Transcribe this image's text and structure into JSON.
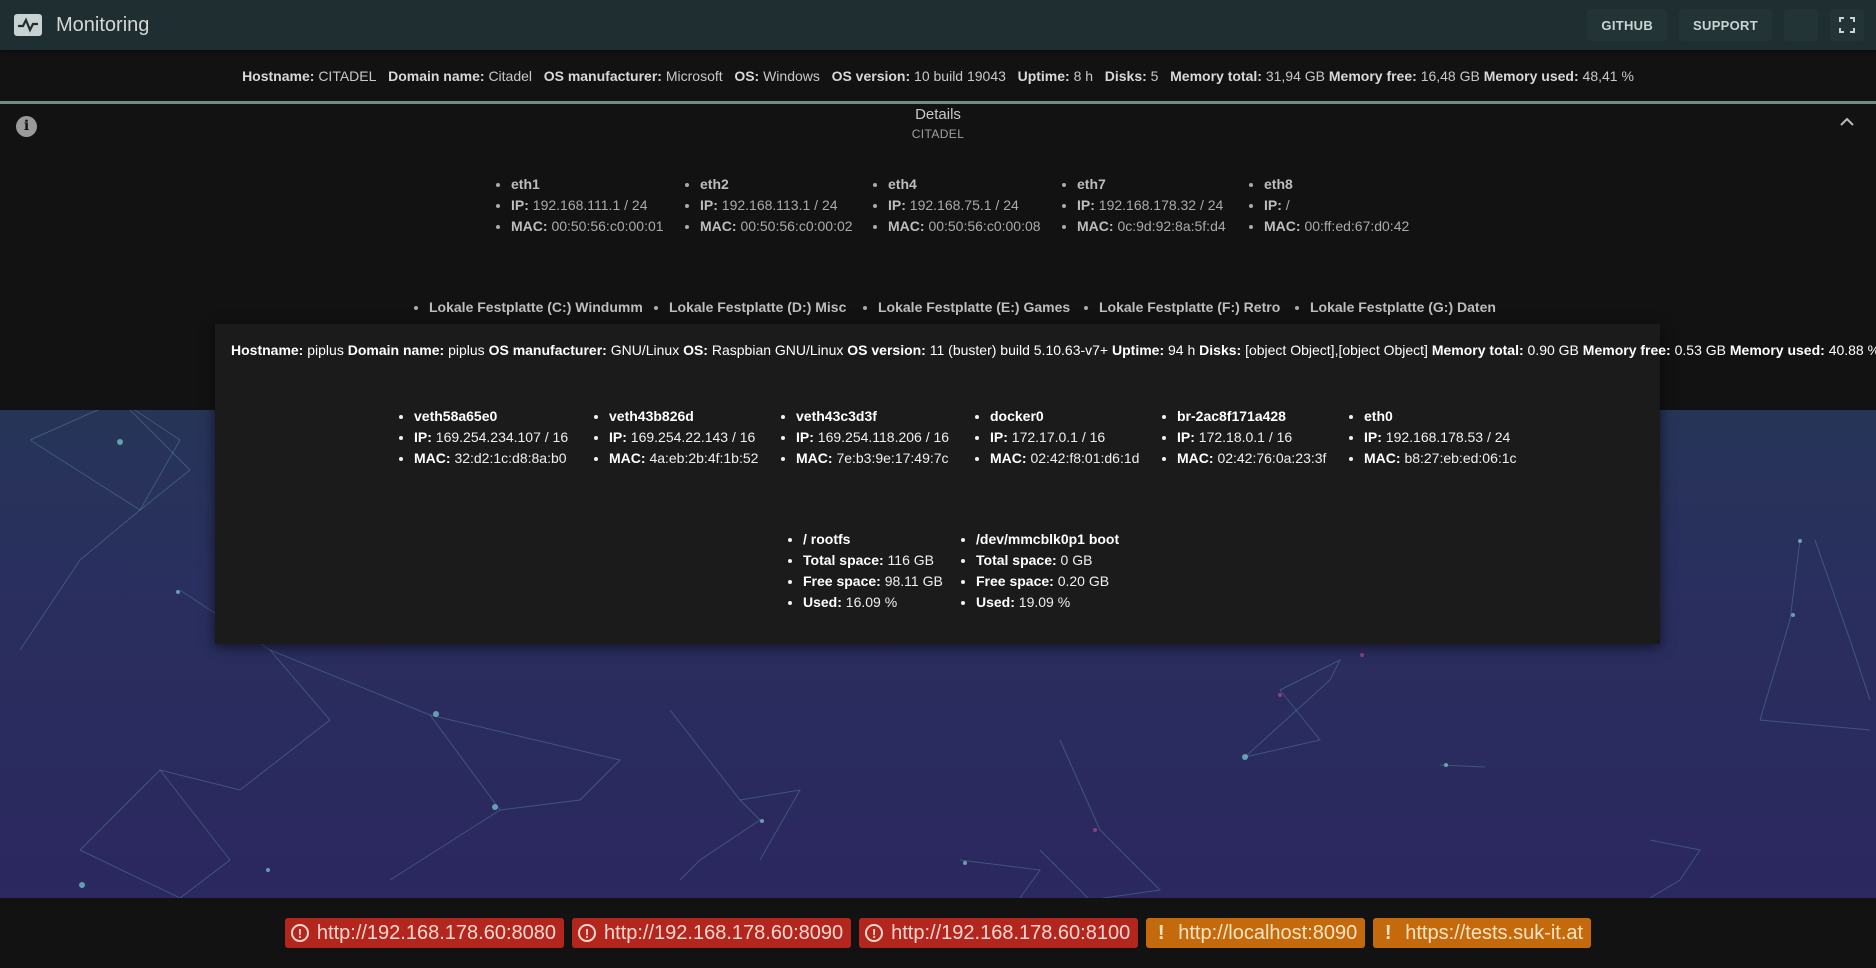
{
  "app": {
    "title": "Monitoring",
    "logo_icon": "activity-monitor-icon"
  },
  "toolbar": {
    "github_label": "GITHUB",
    "support_label": "SUPPORT",
    "theme_icon": "moon-icon",
    "fullscreen_icon": "fullscreen-icon"
  },
  "host1": {
    "hostname_label": "Hostname:",
    "hostname": "CITADEL",
    "domain_label": "Domain name:",
    "domain": "Citadel",
    "manufacturer_label": "OS manufacturer:",
    "manufacturer": "Microsoft",
    "os_label": "OS:",
    "os": "Windows",
    "version_label": "OS version:",
    "version": "10 build 19043",
    "uptime_label": "Uptime:",
    "uptime": "8 h",
    "disks_label": "Disks:",
    "disks": "5",
    "mem_total_label": "Memory total:",
    "mem_total": "31,94 GB",
    "mem_free_label": "Memory free:",
    "mem_free": "16,48 GB",
    "mem_used_label": "Memory used:",
    "mem_used": "48,41 %"
  },
  "details": {
    "title": "Details",
    "subtitle": "CITADEL",
    "ip_label": "IP:",
    "mac_label": "MAC:",
    "interfaces": [
      {
        "name": "eth1",
        "ip": "192.168.111.1 / 24",
        "mac": "00:50:56:c0:00:01"
      },
      {
        "name": "eth2",
        "ip": "192.168.113.1 / 24",
        "mac": "00:50:56:c0:00:02"
      },
      {
        "name": "eth4",
        "ip": "192.168.75.1 / 24",
        "mac": "00:50:56:c0:00:08"
      },
      {
        "name": "eth7",
        "ip": "192.168.178.32 / 24",
        "mac": "0c:9d:92:8a:5f:d4"
      },
      {
        "name": "eth8",
        "ip": "/",
        "mac": "00:ff:ed:67:d0:42"
      }
    ],
    "disks": [
      {
        "name": "Lokale Festplatte (C:) Windumm"
      },
      {
        "name": "Lokale Festplatte (D:) Misc"
      },
      {
        "name": "Lokale Festplatte (E:) Games"
      },
      {
        "name": "Lokale Festplatte (F:) Retro"
      },
      {
        "name": "Lokale Festplatte (G:) Daten"
      }
    ]
  },
  "host2": {
    "hostname_label": "Hostname:",
    "hostname": "piplus",
    "domain_label": "Domain name:",
    "domain": "piplus",
    "manufacturer_label": "OS manufacturer:",
    "manufacturer": "GNU/Linux",
    "os_label": "OS:",
    "os": "Raspbian GNU/Linux",
    "version_label": "OS version:",
    "version": "11 (buster) build 5.10.63-v7+",
    "uptime_label": "Uptime:",
    "uptime": "94 h",
    "disks_label": "Disks:",
    "disks": [
      {
        "name": "/ rootfs",
        "total": "116 GB",
        "free": "98.11 GB",
        "used": "16.09 %"
      },
      {
        "name": "/dev/mmcblk0p1 boot",
        "total": "0 GB",
        "free": "0.20 GB",
        "used": "19.09 %"
      }
    ],
    "mem_total_label": "Memory total:",
    "mem_total": "0.90 GB",
    "mem_free_label": "Memory free:",
    "mem_free": "0.53 GB",
    "mem_used_label": "Memory used:",
    "mem_used": "40.88 %",
    "ip_label": "IP:",
    "mac_label": "MAC:",
    "total_label": "Total space:",
    "free_label": "Free space:",
    "used_label": "Used:",
    "interfaces": [
      {
        "name": "veth58a65e0",
        "ip": "169.254.234.107 / 16",
        "mac": "32:d2:1c:d8:8a:b0"
      },
      {
        "name": "veth43b826d",
        "ip": "169.254.22.143 / 16",
        "mac": "4a:eb:2b:4f:1b:52"
      },
      {
        "name": "veth43c3d3f",
        "ip": "169.254.118.206 / 16",
        "mac": "7e:b3:9e:17:49:7c"
      },
      {
        "name": "docker0",
        "ip": "172.17.0.1 / 16",
        "mac": "02:42:f8:01:d6:1d"
      },
      {
        "name": "br-2ac8f171a428",
        "ip": "172.18.0.1 / 16",
        "mac": "02:42:76:0a:23:3f"
      },
      {
        "name": "eth0",
        "ip": "192.168.178.53 / 24",
        "mac": "b8:27:eb:ed:06:1c"
      }
    ]
  },
  "footer": {
    "urls": [
      {
        "label": "http://192.168.178.60:8080",
        "status": "error",
        "icon": "error-circle-icon",
        "icon_glyph": "!"
      },
      {
        "label": "http://192.168.178.60:8090",
        "status": "error",
        "icon": "error-circle-icon",
        "icon_glyph": "!"
      },
      {
        "label": "http://192.168.178.60:8100",
        "status": "error",
        "icon": "error-circle-icon",
        "icon_glyph": "!"
      },
      {
        "label": "http://localhost:8090",
        "status": "warning",
        "icon": "exclamation-icon",
        "icon_glyph": "!"
      },
      {
        "label": "https://tests.suk-it.at",
        "status": "warning",
        "icon": "exclamation-icon",
        "icon_glyph": "!"
      }
    ]
  },
  "colors": {
    "error": "#b3261e",
    "warning": "#c46a0c",
    "appbar": "#1f2e30",
    "panel": "#121212",
    "accent_line": "#6f8b86"
  }
}
